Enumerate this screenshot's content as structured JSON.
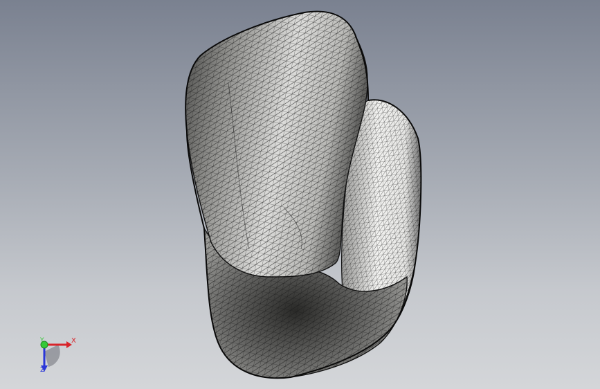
{
  "viewport": {
    "background_top": "#7a8190",
    "background_bottom": "#d4d6d9"
  },
  "model": {
    "name": "mesh-model",
    "shading": "shaded-with-edges"
  },
  "triad": {
    "x_label": "X",
    "y_label": "Y",
    "z_label": "Z",
    "x_color": "#d8242a",
    "y_color": "#36c936",
    "z_color": "#2a36d8"
  }
}
